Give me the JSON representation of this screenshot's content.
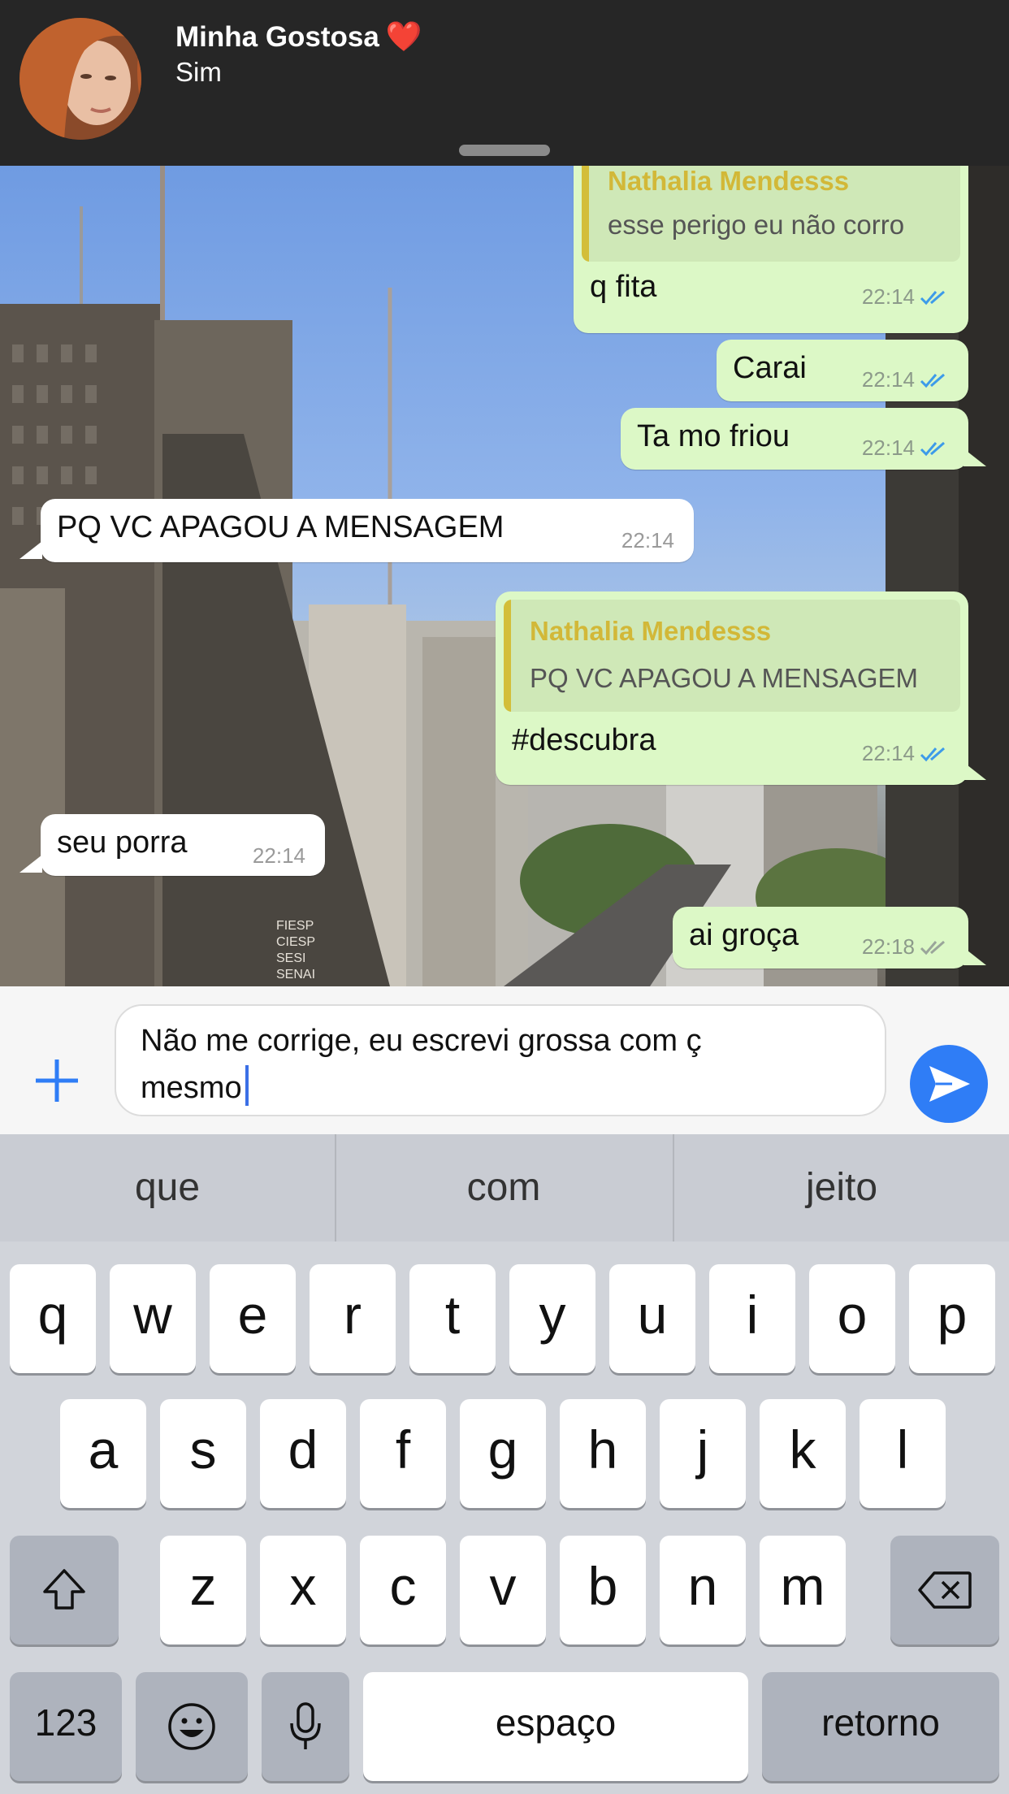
{
  "notification": {
    "contact_name": "Minha Gostosa",
    "emoji": "❤️",
    "message": "Sim"
  },
  "chat": {
    "messages": [
      {
        "id": "m1",
        "direction": "out",
        "quote_author": "Nathalia Mendesss",
        "quote_text": "esse perigo eu não corro",
        "text": "q fita",
        "time": "22:14",
        "status": "read"
      },
      {
        "id": "m2",
        "direction": "out",
        "text": "Carai",
        "time": "22:14",
        "status": "read"
      },
      {
        "id": "m3",
        "direction": "out",
        "text": "Ta mo friou",
        "time": "22:14",
        "status": "read"
      },
      {
        "id": "m4",
        "direction": "in",
        "text": "PQ VC APAGOU A MENSAGEM",
        "time": "22:14"
      },
      {
        "id": "m5",
        "direction": "out",
        "quote_author": "Nathalia Mendesss",
        "quote_text": "PQ VC APAGOU A MENSAGEM",
        "text": "#descubra",
        "time": "22:14",
        "status": "read"
      },
      {
        "id": "m6",
        "direction": "in",
        "text": "seu porra",
        "time": "22:14"
      },
      {
        "id": "m7",
        "direction": "out",
        "text": "ai groça",
        "time": "22:18",
        "status": "delivered"
      }
    ],
    "background_signs": [
      "FIESP",
      "CIESP",
      "SESI",
      "SENAI"
    ]
  },
  "composer": {
    "text_line1": "Não me corrige, eu escrevi grossa com ç",
    "text_line2": "mesmo",
    "plus_icon": "plus-icon",
    "send_icon": "send-icon"
  },
  "keyboard": {
    "suggestions": [
      "que",
      "com",
      "jeito"
    ],
    "row1": [
      "q",
      "w",
      "e",
      "r",
      "t",
      "y",
      "u",
      "i",
      "o",
      "p"
    ],
    "row2": [
      "a",
      "s",
      "d",
      "f",
      "g",
      "h",
      "j",
      "k",
      "l"
    ],
    "row3": [
      "z",
      "x",
      "c",
      "v",
      "b",
      "n",
      "m"
    ],
    "numbers_label": "123",
    "space_label": "espaço",
    "return_label": "retorno",
    "shift_icon": "shift-icon",
    "delete_icon": "backspace-icon",
    "emoji_icon": "emoji-icon",
    "mic_icon": "microphone-icon"
  },
  "colors": {
    "banner_bg": "#262626",
    "outgoing_bubble": "#dcf8c6",
    "incoming_bubble": "#ffffff",
    "quote_author": "#d2b838",
    "read_tick": "#3d9be9",
    "send_button": "#2f7df6",
    "caret": "#3b6fe6"
  }
}
